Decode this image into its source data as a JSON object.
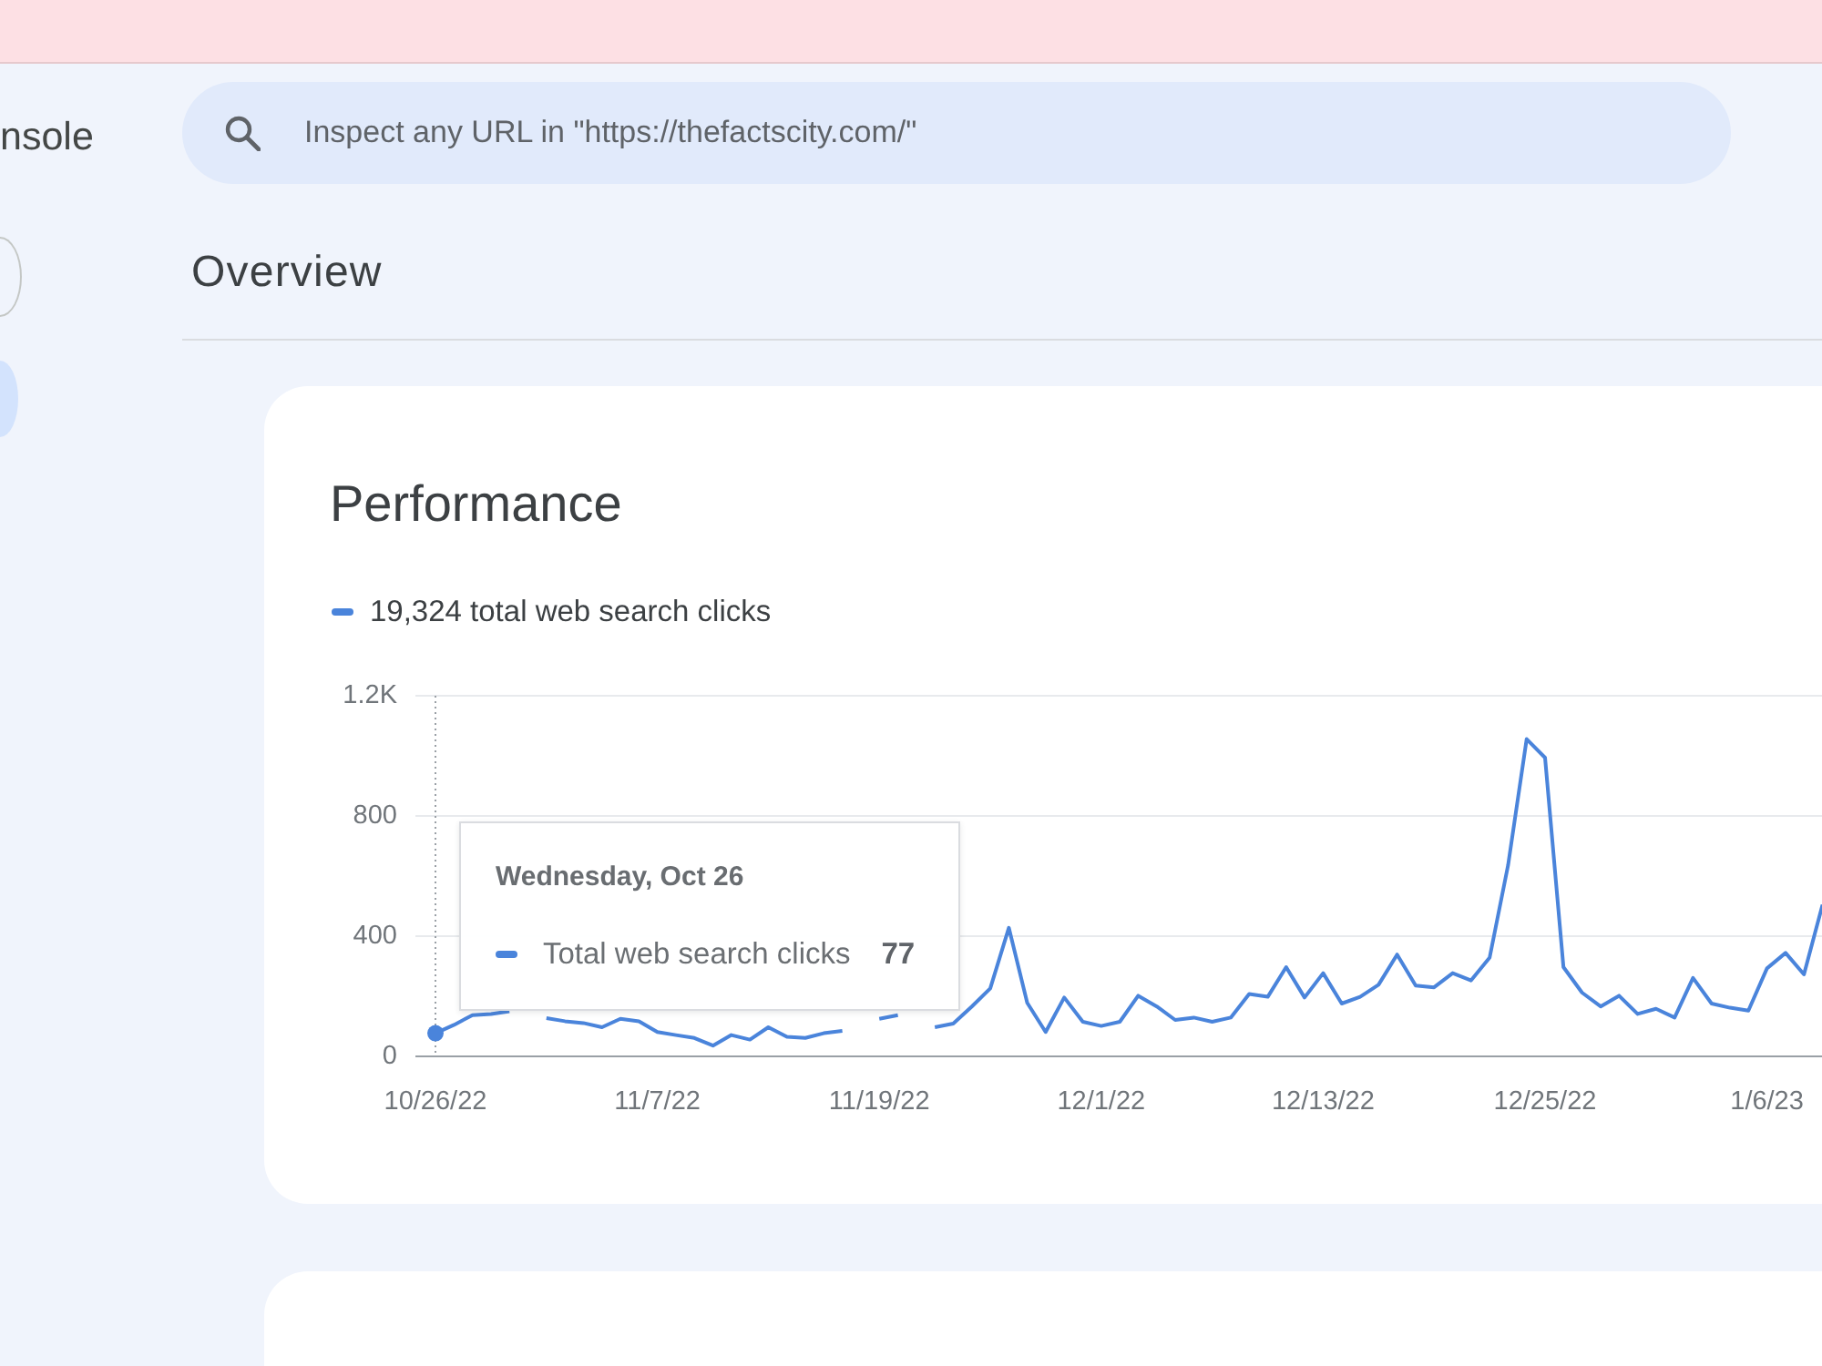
{
  "sidebar": {
    "title": "nsole",
    "nav_items": [
      {
        "selected": true
      }
    ]
  },
  "search": {
    "placeholder": "Inspect any URL in \"https://thefactscity.com/\""
  },
  "page_title": "Overview",
  "performance": {
    "title": "Performance",
    "legend": "19,324 total web search clicks",
    "chart_data": {
      "type": "line",
      "ylim": [
        0,
        1200
      ],
      "yticks": [
        0,
        400,
        800,
        {
          "value": 1200,
          "label": "1.2K"
        }
      ],
      "categories": [
        "10/26/22",
        null,
        null,
        null,
        null,
        null,
        null,
        null,
        null,
        null,
        null,
        null,
        "11/7/22",
        null,
        null,
        null,
        null,
        null,
        null,
        null,
        null,
        null,
        null,
        null,
        "11/19/22",
        null,
        null,
        null,
        null,
        null,
        null,
        null,
        null,
        null,
        null,
        null,
        "12/1/22",
        null,
        null,
        null,
        null,
        null,
        null,
        null,
        null,
        null,
        null,
        null,
        "12/13/22",
        null,
        null,
        null,
        null,
        null,
        null,
        null,
        null,
        null,
        null,
        null,
        "12/25/22",
        null,
        null,
        null,
        null,
        null,
        null,
        null,
        null,
        null,
        null,
        null,
        "1/6/23",
        null,
        null,
        null
      ],
      "series": [
        {
          "name": "Total web search clicks",
          "color": "#4a84db",
          "values": [
            77,
            105,
            137,
            141,
            150,
            null,
            127,
            117,
            111,
            97,
            125,
            117,
            81,
            71,
            61,
            36,
            71,
            56,
            97,
            65,
            61,
            77,
            85,
            null,
            125,
            137,
            null,
            97,
            109,
            166,
            226,
            428,
            178,
            81,
            196,
            115,
            101,
            115,
            202,
            166,
            121,
            129,
            115,
            129,
            208,
            198,
            297,
            196,
            277,
            176,
            198,
            238,
            339,
            236,
            230,
            277,
            253,
            329,
            636,
            1056,
            994,
            297,
            212,
            166,
            202,
            141,
            158,
            129,
            261,
            176,
            162,
            152,
            293,
            344,
            273,
            505
          ]
        }
      ],
      "annotations": [
        {
          "x": "10/26/22"
        }
      ]
    },
    "tooltip": {
      "title": "Wednesday, Oct 26",
      "value": "77"
    }
  }
}
